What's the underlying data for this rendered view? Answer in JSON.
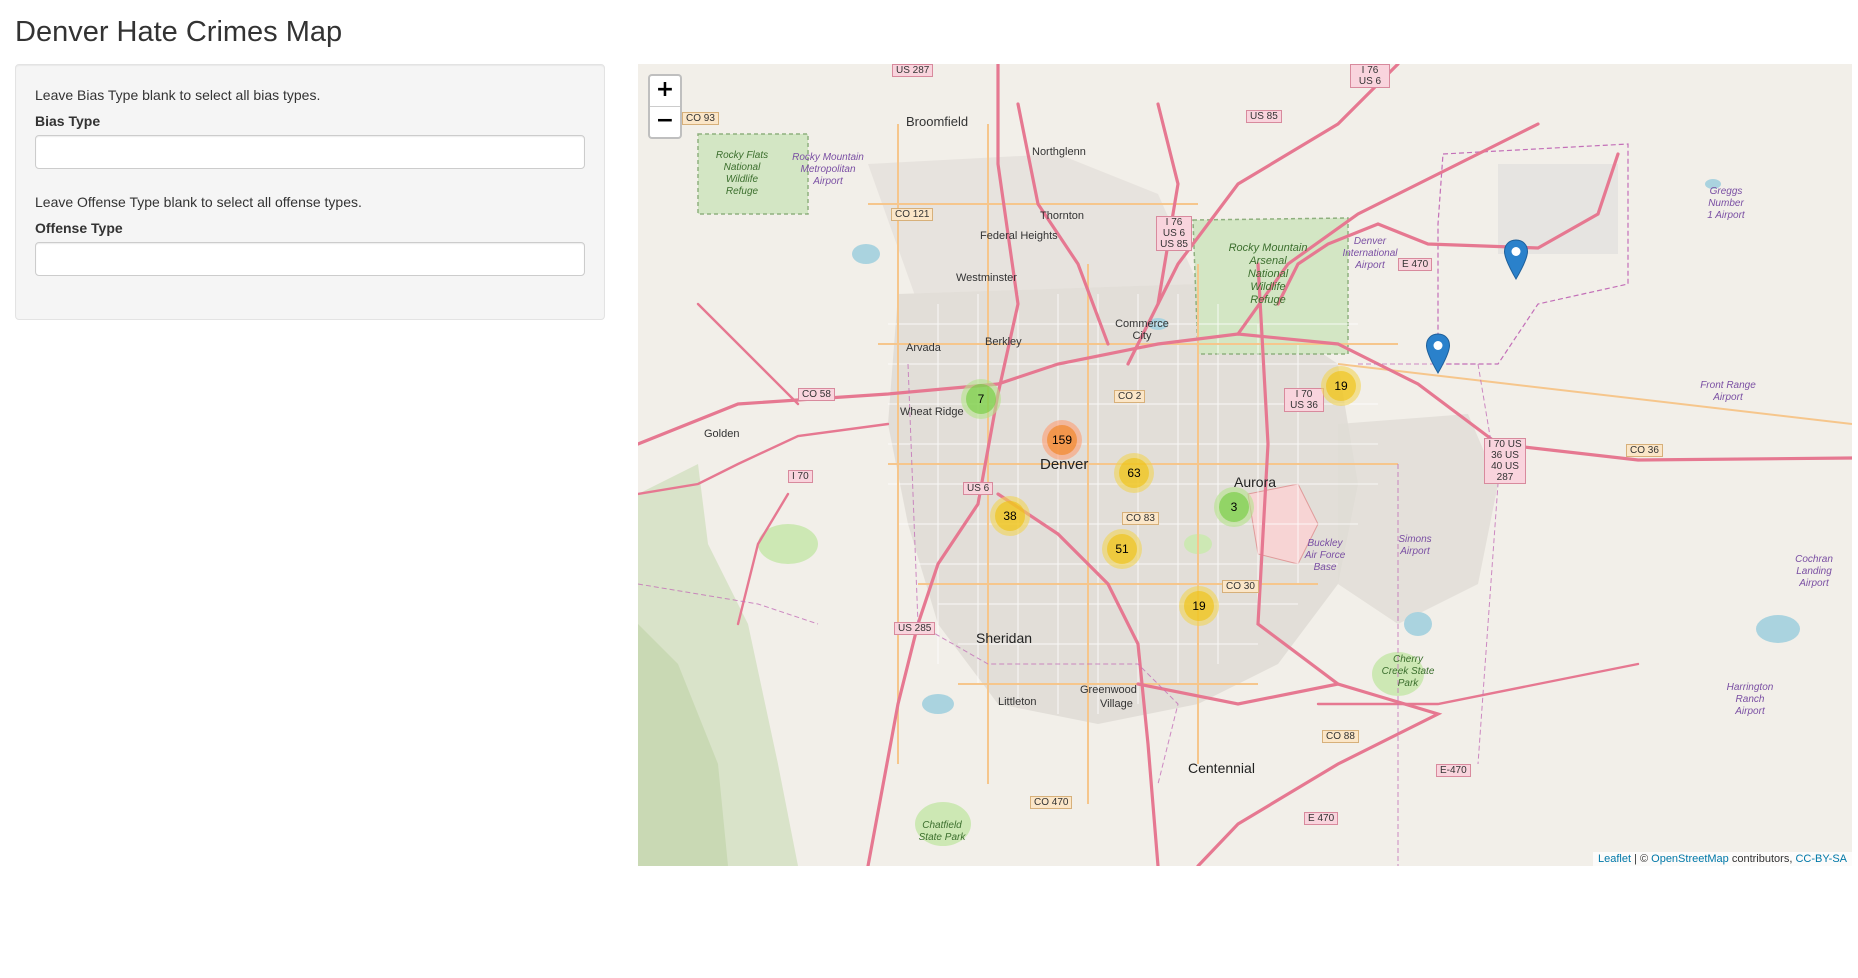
{
  "page": {
    "title": "Denver Hate Crimes Map"
  },
  "sidebar": {
    "bias_help": "Leave Bias Type blank to select all bias types.",
    "bias_label": "Bias Type",
    "bias_value": "",
    "offense_help": "Leave Offense Type blank to select all offense types.",
    "offense_label": "Offense Type",
    "offense_value": ""
  },
  "map": {
    "zoom_in": "+",
    "zoom_out": "−",
    "clusters": [
      {
        "count": "7",
        "size": "small"
      },
      {
        "count": "159",
        "size": "large"
      },
      {
        "count": "63",
        "size": "med"
      },
      {
        "count": "19",
        "size": "med"
      },
      {
        "count": "3",
        "size": "small"
      },
      {
        "count": "38",
        "size": "med"
      },
      {
        "count": "51",
        "size": "med"
      },
      {
        "count": "19",
        "size": "med"
      }
    ],
    "markers": [
      {
        "icon": "map-pin-icon"
      },
      {
        "icon": "map-pin-icon"
      }
    ],
    "marker_color": "#2a81cb",
    "places": {
      "broomfield": "Broomfield",
      "northglenn": "Northglenn",
      "thornton": "Thornton",
      "federal_heights": "Federal Heights",
      "westminster": "Westminster",
      "commerce_city": "Commerce City",
      "arvada": "Arvada",
      "berkley": "Berkley",
      "wheat_ridge": "Wheat Ridge",
      "golden": "Golden",
      "denver": "Denver",
      "aurora": "Aurora",
      "sheridan": "Sheridan",
      "littleton": "Littleton",
      "greenwood": "Greenwood",
      "village": "Village",
      "centennial": "Centennial",
      "rma1": "Rocky Mountain",
      "rma2": "Arsenal",
      "rma3": "National",
      "rma4": "Wildlife",
      "rma5": "Refuge",
      "rf1": "Rocky Flats",
      "rf2": "National",
      "rf3": "Wildlife",
      "rf4": "Refuge",
      "dia1": "Denver",
      "dia2": "International",
      "dia3": "Airport",
      "buckley1": "Buckley",
      "buckley2": "Air Force",
      "buckley3": "Base",
      "cherry1": "Cherry",
      "cherry2": "Creek State",
      "cherry3": "Park",
      "chatfield1": "Chatfield",
      "chatfield2": "State Park",
      "frontrange1": "Front Range",
      "frontrange2": "Airport",
      "greggs1": "Greggs",
      "greggs2": "Number",
      "greggs3": "1 Airport",
      "cochran1": "Cochran",
      "cochran2": "Landing",
      "cochran3": "Airport",
      "harrington1": "Harrington",
      "harrington2": "Ranch",
      "harrington3": "Airport",
      "rmma1": "Rocky Mountain",
      "rmma2": "Metropolitan",
      "rmma3": "Airport",
      "simons1": "Simons",
      "simons2": "Airport"
    },
    "shields": {
      "i70_w": "I 70",
      "us6_w": "US 6",
      "co58": "CO 58",
      "co93": "CO 93",
      "co121": "CO 121",
      "co2": "CO 2",
      "co83": "CO 83",
      "co30": "CO 30",
      "co88": "CO 88",
      "co470": "CO 470",
      "us285": "US 285",
      "us287": "US 287",
      "us85": "US 85",
      "e470_n": "E 470",
      "e470_s": "E 470",
      "e470_e": "E-470",
      "co36": "CO 36",
      "i70us36": "I 70 US 36",
      "i76": "I 76 US 6 US 85",
      "i76b": "I 76 US 6",
      "i70big": "I 70 US 36 US 40 US 287"
    },
    "attribution": {
      "leaflet": "Leaflet",
      "sep": " | © ",
      "osm": "OpenStreetMap",
      "contrib": " contributors, ",
      "license": "CC-BY-SA"
    }
  }
}
